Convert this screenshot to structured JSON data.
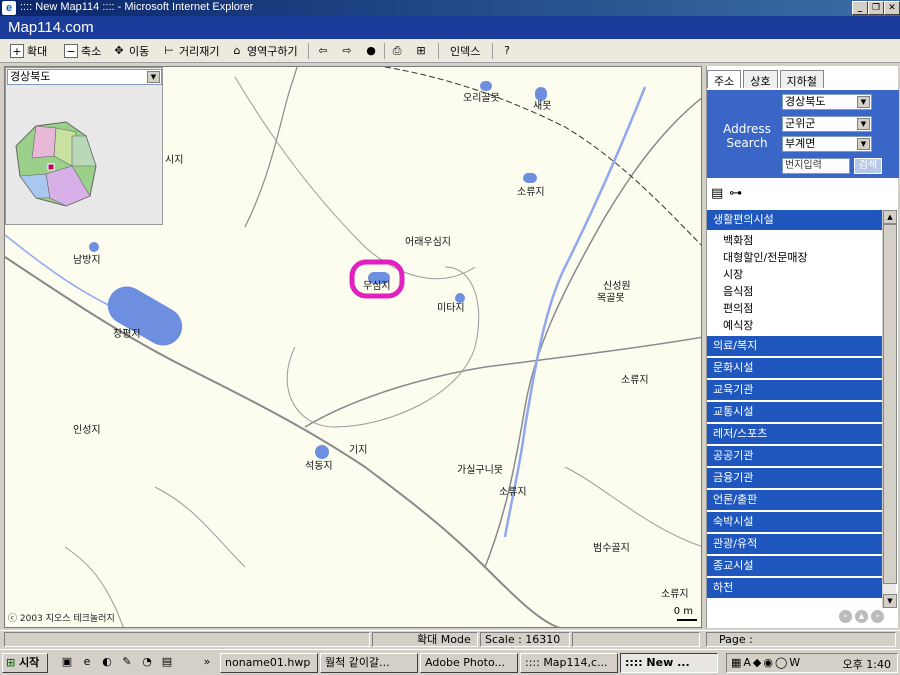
{
  "window": {
    "title": ":::: New Map114 :::: - Microsoft Internet Explorer",
    "icon": "ie-icon",
    "controls": [
      "_",
      "❐",
      "✕"
    ]
  },
  "brand": {
    "logo": "Map114.com"
  },
  "toolbar": {
    "zoom_in": "확대",
    "zoom_out": "축소",
    "move": "이동",
    "measure": "거리재기",
    "area": "영역구하기",
    "print_icon": "printer-icon",
    "index": "인덱스"
  },
  "overview": {
    "region_select": "경상북도"
  },
  "map": {
    "places": [
      {
        "name": "오리골못"
      },
      {
        "name": "새못"
      },
      {
        "name": "시지"
      },
      {
        "name": "소류지"
      },
      {
        "name": "남방지"
      },
      {
        "name": "어래우심지"
      },
      {
        "name": "무심지"
      },
      {
        "name": "신성원"
      },
      {
        "name": "목골못"
      },
      {
        "name": "미타지"
      },
      {
        "name": "창평지"
      },
      {
        "name": "소류지"
      },
      {
        "name": "인성지"
      },
      {
        "name": "기지"
      },
      {
        "name": "석동지"
      },
      {
        "name": "가실구니못"
      },
      {
        "name": "소류지"
      },
      {
        "name": "범수골지"
      },
      {
        "name": "소류지"
      }
    ],
    "copyright": "ⓒ 2003 지오스 테크놀러지",
    "scale_label": "0 m",
    "highlight_color": "#e020c0"
  },
  "panel": {
    "tabs": [
      "주소",
      "상호",
      "지하철"
    ],
    "address_label": "Address Search",
    "province": "경상북도",
    "county": "군위군",
    "town": "부계면",
    "number_placeholder": "번지입력",
    "search_button": "검색",
    "categories": [
      {
        "label": "생활편의시설",
        "subs": [
          "백화점",
          "대형할인/전문매장",
          "시장",
          "음식점",
          "편의점",
          "예식장"
        ]
      },
      {
        "label": "의료/복지"
      },
      {
        "label": "문화시설"
      },
      {
        "label": "교육기관"
      },
      {
        "label": "교통시설"
      },
      {
        "label": "레저/스포츠"
      },
      {
        "label": "공공기관"
      },
      {
        "label": "금융기관"
      },
      {
        "label": "언론/출판"
      },
      {
        "label": "숙박시설"
      },
      {
        "label": "관광/유적"
      },
      {
        "label": "종교시설"
      },
      {
        "label": "하천"
      }
    ]
  },
  "status": {
    "mode_label": "확대 Mode",
    "scale_text": "Scale : 16310",
    "page_label": "Page :"
  },
  "taskbar": {
    "start": "시작",
    "tasks": [
      {
        "label": "noname01.hwp"
      },
      {
        "label": "월척 같이갈..."
      },
      {
        "label": "Adobe Photo..."
      },
      {
        "label": ":::: Map114,c..."
      },
      {
        "label": ":::: New ..."
      }
    ],
    "clock": "오후 1:40"
  }
}
